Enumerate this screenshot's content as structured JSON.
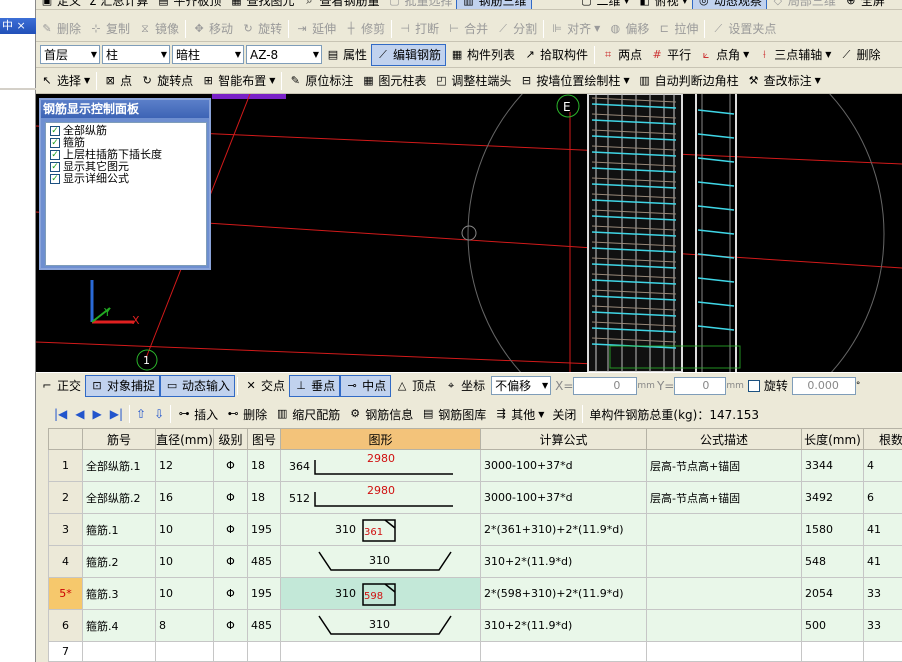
{
  "left_panel": {
    "caption": "中 ×"
  },
  "toolbar1": [
    "定义",
    "Σ 汇总计算",
    "平齐板顶",
    "查找图元",
    "查看钢筋量",
    "批量选择",
    "钢筋三维",
    "二维",
    "俯视",
    "动态观察",
    "局部三维",
    "全屏"
  ],
  "toolbar2": [
    "删除",
    "复制",
    "镜像",
    "移动",
    "旋转",
    "延伸",
    "修剪",
    "打断",
    "合并",
    "分割",
    "对齐",
    "偏移",
    "拉伸",
    "设置夹点"
  ],
  "toolbar3": {
    "floor": "首层",
    "type": "柱",
    "subtype": "暗柱",
    "name": "AZ-8",
    "buttons": [
      "属性",
      "编辑钢筋",
      "构件列表",
      "拾取构件",
      "两点",
      "平行",
      "点角",
      "三点辅轴",
      "删除"
    ]
  },
  "toolbar4": [
    "选择",
    "点",
    "旋转点",
    "智能布置",
    "原位标注",
    "图元柱表",
    "调整柱端头",
    "按墙位置绘制柱",
    "自动判断边角柱",
    "查改标注"
  ],
  "control_panel": {
    "title": "钢筋显示控制面板",
    "items": [
      "全部纵筋",
      "箍筋",
      "上层柱插筋下插长度",
      "显示其它图元",
      "显示详细公式"
    ]
  },
  "viewport": {
    "axis_label_e": "E",
    "axis_label_1": "1"
  },
  "statusbar": {
    "buttons": [
      "正交",
      "对象捕捉",
      "动态输入",
      "交点",
      "垂点",
      "中点",
      "顶点",
      "坐标"
    ],
    "offset_mode": "不偏移",
    "x_label": "X=",
    "x_value": "0",
    "unit1": "mm",
    "y_label": "Y=",
    "y_value": "0",
    "unit2": "mm",
    "rotate_label": "旋转",
    "rotate_value": "0.000",
    "deg": "°"
  },
  "gridbar": {
    "buttons": [
      "插入",
      "删除",
      "缩尺配筋",
      "钢筋信息",
      "钢筋图库",
      "其他",
      "关闭"
    ],
    "total_label": "单构件钢筋总重(kg)：147.153"
  },
  "table": {
    "headers": [
      "筋号",
      "直径(mm)",
      "级别",
      "图号",
      "图形",
      "计算公式",
      "公式描述",
      "长度(mm)",
      "根数"
    ],
    "rows": [
      {
        "num": "1",
        "name": "全部纵筋.1",
        "dia": "12",
        "grade": "Φ",
        "fig": "18",
        "shape": "bar",
        "s_left": "364",
        "s_main": "2980",
        "formula": "3000-100+37*d",
        "desc": "层高-节点高+锚固",
        "len": "3344",
        "count": "4"
      },
      {
        "num": "2",
        "name": "全部纵筋.2",
        "dia": "16",
        "grade": "Φ",
        "fig": "18",
        "shape": "bar",
        "s_left": "512",
        "s_main": "2980",
        "formula": "3000-100+37*d",
        "desc": "层高-节点高+锚固",
        "len": "3492",
        "count": "6"
      },
      {
        "num": "3",
        "name": "箍筋.1",
        "dia": "10",
        "grade": "Φ",
        "fig": "195",
        "shape": "stirrup",
        "s_left": "310",
        "s_main": "361",
        "formula": "2*(361+310)+2*(11.9*d)",
        "desc": "",
        "len": "1580",
        "count": "41"
      },
      {
        "num": "4",
        "name": "箍筋.2",
        "dia": "10",
        "grade": "Φ",
        "fig": "485",
        "shape": "tie",
        "s_left": "",
        "s_main": "310",
        "formula": "310+2*(11.9*d)",
        "desc": "",
        "len": "548",
        "count": "41"
      },
      {
        "num": "5*",
        "name": "箍筋.3",
        "dia": "10",
        "grade": "Φ",
        "fig": "195",
        "shape": "stirrup",
        "s_left": "310",
        "s_main": "598",
        "formula": "2*(598+310)+2*(11.9*d)",
        "desc": "",
        "len": "2054",
        "count": "33"
      },
      {
        "num": "6",
        "name": "箍筋.4",
        "dia": "8",
        "grade": "Φ",
        "fig": "485",
        "shape": "tie",
        "s_left": "",
        "s_main": "310",
        "formula": "310+2*(11.9*d)",
        "desc": "",
        "len": "500",
        "count": "33"
      },
      {
        "num": "7",
        "name": "",
        "dia": "",
        "grade": "",
        "fig": "",
        "shape": "",
        "s_left": "",
        "s_main": "",
        "formula": "",
        "desc": "",
        "len": "",
        "count": ""
      }
    ]
  }
}
